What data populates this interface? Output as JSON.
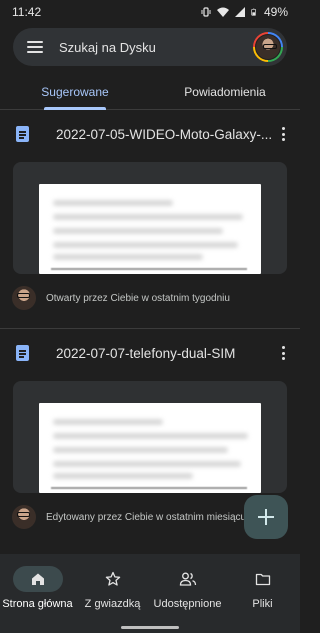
{
  "status_bar": {
    "time": "11:42",
    "battery": "49%"
  },
  "search": {
    "placeholder": "Szukaj na Dysku"
  },
  "tabs": [
    {
      "label": "Sugerowane",
      "active": true
    },
    {
      "label": "Powiadomienia",
      "active": false
    }
  ],
  "files": [
    {
      "name": "2022-07-05-WIDEO-Moto-Galaxy-...",
      "activity": "Otwarty przez Ciebie w ostatnim tygodniu",
      "icon": "docs-icon"
    },
    {
      "name": "2022-07-07-telefony-dual-SIM",
      "activity": "Edytowany przez Ciebie w ostatnim miesiącu",
      "icon": "docs-icon"
    }
  ],
  "fab": {
    "icon": "plus-icon"
  },
  "bottom_nav": [
    {
      "label": "Strona główna",
      "icon": "home-icon",
      "active": true
    },
    {
      "label": "Z gwiazdką",
      "icon": "star-icon",
      "active": false
    },
    {
      "label": "Udostępnione",
      "icon": "people-icon",
      "active": false
    },
    {
      "label": "Pliki",
      "icon": "folder-icon",
      "active": false
    }
  ],
  "colors": {
    "accent": "#a8c7fa",
    "background": "#1f1f1f",
    "doc_icon": "#8ab4f8",
    "fab": "#3e5456"
  }
}
